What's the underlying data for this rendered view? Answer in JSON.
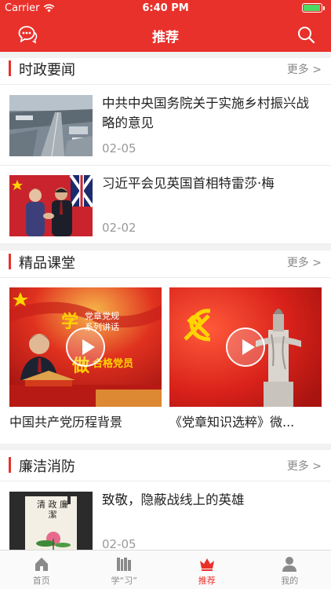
{
  "status": {
    "carrier": "Carrier",
    "time": "6:40 PM",
    "battery_level": 0.95
  },
  "header": {
    "title": "推荐",
    "left_icon": "chat-icon",
    "right_icon": "search-icon"
  },
  "sections": {
    "politics": {
      "title": "时政要闻",
      "more": "更多 >",
      "items": [
        {
          "title": "中共中央国务院关于实施乡村振兴战略的意见",
          "date": "02-05"
        },
        {
          "title": "习近平会见英国首相特雷莎·梅",
          "date": "02-02"
        }
      ]
    },
    "classroom": {
      "title": "精品课堂",
      "more": "更多 >",
      "videos": [
        {
          "caption": "中国共产党历程背景",
          "overlay_1": "学",
          "overlay_2": "党章党规",
          "overlay_3": "系列讲话",
          "overlay_4": "做",
          "overlay_5": "合格党员"
        },
        {
          "caption": "《党章知识选粹》微..."
        }
      ]
    },
    "integrity": {
      "title": "廉洁消防",
      "more": "更多 >",
      "items": [
        {
          "title": "致敬，隐蔽战线上的英雄",
          "date": "02-05",
          "art_text": "清 政 廉 潔"
        }
      ]
    }
  },
  "tabbar": [
    {
      "label": "首页",
      "icon": "home-icon",
      "active": false
    },
    {
      "label": "学“习”",
      "icon": "books-icon",
      "active": false
    },
    {
      "label": "推荐",
      "icon": "crown-icon",
      "active": true
    },
    {
      "label": "我的",
      "icon": "user-icon",
      "active": false
    }
  ],
  "colors": {
    "brand_red": "#e8312b",
    "active_tab": "#e8312b"
  }
}
